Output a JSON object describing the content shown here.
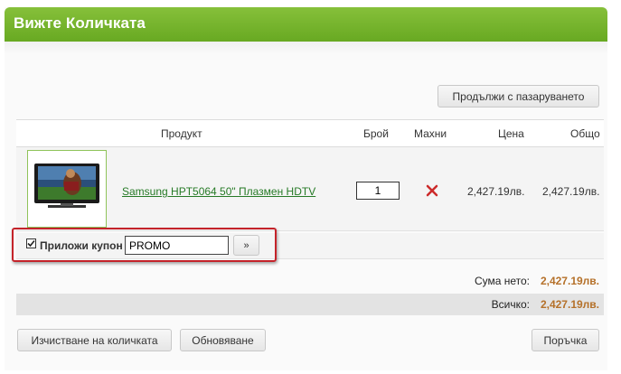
{
  "header": {
    "title": "Вижте Количката"
  },
  "actions": {
    "continue_shopping": "Продължи с пазаруването",
    "clear_cart": "Изчистване на количката",
    "update": "Обновяване",
    "checkout": "Поръчка"
  },
  "table": {
    "columns": {
      "product": "Продукт",
      "quantity": "Брой",
      "remove": "Махни",
      "price": "Цена",
      "total": "Общо"
    },
    "rows": [
      {
        "name": "Samsung HPT5064 50\" Плазмен HDTV",
        "quantity": "1",
        "price": "2,427.19лв.",
        "total": "2,427.19лв."
      }
    ]
  },
  "coupon": {
    "label": "Приложи купон",
    "value": "PROMO",
    "apply_label": "»",
    "checked": true
  },
  "summary": {
    "subtotal_label": "Сума нето:",
    "subtotal_value": "2,427.19лв.",
    "grand_label": "Всичко:",
    "grand_value": "2,427.19лв."
  },
  "colors": {
    "header_green": "#73b12c",
    "link_green": "#267a26",
    "amount_orange": "#b5712a",
    "highlight_red": "#c4232a",
    "remove_red": "#cc2a2a"
  },
  "icons": {
    "remove": "close-x-icon",
    "checkbox": "checkmark-icon"
  }
}
